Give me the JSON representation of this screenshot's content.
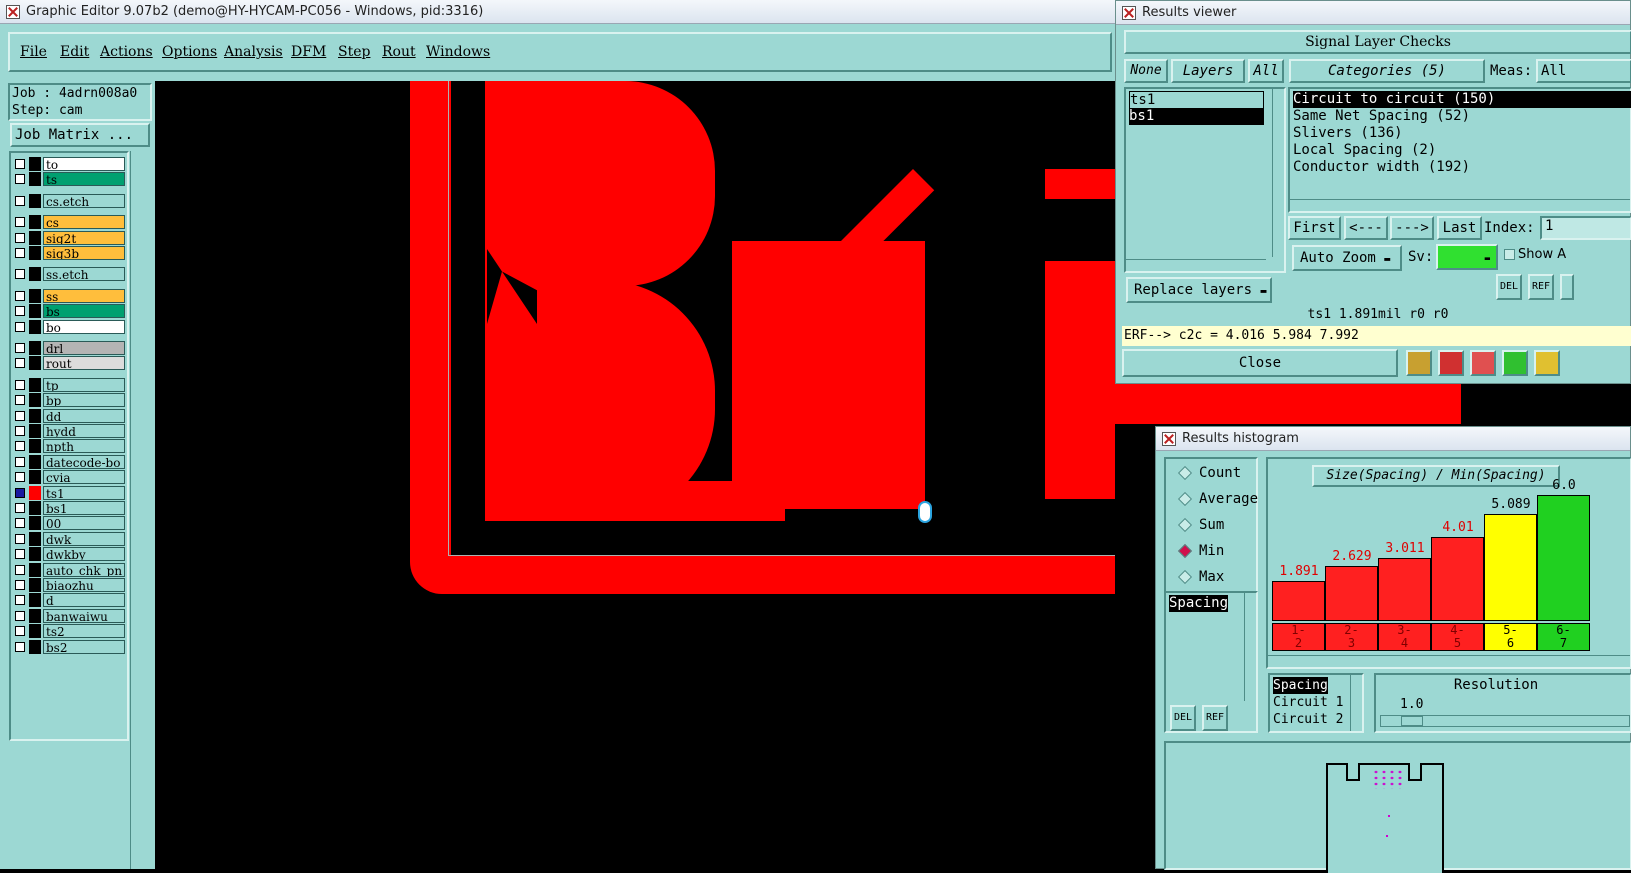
{
  "main_window": {
    "title": "Graphic Editor 9.07b2 (demo@HY-HYCAM-PC056 - Windows, pid:3316)"
  },
  "menu": [
    "File",
    "Edit",
    "Actions",
    "Options",
    "Analysis",
    "DFM",
    "Step",
    "Rout",
    "Windows"
  ],
  "job": {
    "job_label": "Job : 4adrn008a0",
    "step_label": "Step: cam",
    "matrix_button": "Job Matrix ..."
  },
  "layers": [
    {
      "name": "to",
      "color": "#ffffff"
    },
    {
      "name": "ts",
      "color": "#00a070"
    },
    {
      "name": "cs.etch",
      "color": "#9cd8d3"
    },
    {
      "name": "cs",
      "color": "#ffbe3c"
    },
    {
      "name": "sig2t",
      "color": "#ffbe3c"
    },
    {
      "name": "sig3b",
      "color": "#ffbe3c"
    },
    {
      "name": "ss.etch",
      "color": "#9cd8d3"
    },
    {
      "name": "ss",
      "color": "#ffbe3c"
    },
    {
      "name": "bs",
      "color": "#00a070"
    },
    {
      "name": "bo",
      "color": "#ffffff"
    },
    {
      "name": "drl",
      "color": "#b4b4b4"
    },
    {
      "name": "rout",
      "color": "#dcdcdc"
    },
    {
      "name": "tp",
      "color": "#9cd8d3"
    },
    {
      "name": "bp",
      "color": "#9cd8d3"
    },
    {
      "name": "dd",
      "color": "#9cd8d3"
    },
    {
      "name": "hydd",
      "color": "#9cd8d3"
    },
    {
      "name": "npth",
      "color": "#9cd8d3"
    },
    {
      "name": "datecode-bo",
      "color": "#9cd8d3"
    },
    {
      "name": "cvia",
      "color": "#9cd8d3"
    },
    {
      "name": "ts1",
      "color": "#9cd8d3",
      "active": true
    },
    {
      "name": "bs1",
      "color": "#9cd8d3"
    },
    {
      "name": "00",
      "color": "#9cd8d3"
    },
    {
      "name": "dwk",
      "color": "#9cd8d3"
    },
    {
      "name": "dwkby",
      "color": "#9cd8d3"
    },
    {
      "name": "auto_chk_pn",
      "color": "#9cd8d3"
    },
    {
      "name": "biaozhu",
      "color": "#9cd8d3"
    },
    {
      "name": "d",
      "color": "#9cd8d3"
    },
    {
      "name": "banwaiwu",
      "color": "#9cd8d3"
    },
    {
      "name": "ts2",
      "color": "#9cd8d3"
    },
    {
      "name": "bs2",
      "color": "#9cd8d3"
    }
  ],
  "results_viewer": {
    "title": "Results viewer",
    "header": "Signal Layer Checks",
    "btn_none": "None",
    "btn_layers": "Layers",
    "btn_all": "All",
    "layers": [
      "ts1",
      "bs1"
    ],
    "categories_label": "Categories (5)",
    "meas_label": "Meas:",
    "meas_value": "All",
    "categories": [
      "Circuit to circuit (150)",
      "Same Net Spacing (52)",
      "Slivers (136)",
      "Local Spacing (2)",
      "Conductor width (192)"
    ],
    "nav": {
      "first": "First",
      "prev": "<---",
      "next": "--->",
      "last": "Last",
      "index_label": "Index:",
      "index_value": "1"
    },
    "auto_zoom": "Auto Zoom",
    "sv_label": "Sv:",
    "show_label": "Show A",
    "replace_layers": "Replace layers",
    "status": "ts1  1.891mil  r0  r0",
    "erf": "ERF--> c2c = 4.016 5.984 7.992",
    "close": "Close",
    "icon_del": "DEL",
    "icon_ref": "REF"
  },
  "results_histogram": {
    "title": "Results histogram",
    "modes": [
      {
        "label": "Count",
        "selected": false
      },
      {
        "label": "Average",
        "selected": false
      },
      {
        "label": "Sum",
        "selected": false
      },
      {
        "label": "Min",
        "selected": true
      },
      {
        "label": "Max",
        "selected": false
      }
    ],
    "list_item": "Spacing",
    "chart_title": "Size(Spacing) / Min(Spacing)",
    "bars": [
      {
        "bin": "1-2",
        "value": "1.891",
        "level": 0.19,
        "color": "#ff2020"
      },
      {
        "bin": "2-3",
        "value": "2.629",
        "level": 0.26,
        "color": "#ff2020"
      },
      {
        "bin": "3-4",
        "value": "3.011",
        "level": 0.3,
        "color": "#ff2020"
      },
      {
        "bin": "4-5",
        "value": "4.01",
        "level": 0.4,
        "color": "#ff2020"
      },
      {
        "bin": "5-6",
        "value": "5.089",
        "level": 0.51,
        "color": "#ffff00"
      },
      {
        "bin": "6-7",
        "value": "6.0",
        "level": 0.6,
        "color": "#20d020"
      }
    ],
    "attr_list": [
      "Spacing",
      "Circuit 1",
      "Circuit 2"
    ],
    "resolution_label": "Resolution",
    "resolution_value": "1.0",
    "icon_del": "DEL",
    "icon_ref": "REF"
  }
}
